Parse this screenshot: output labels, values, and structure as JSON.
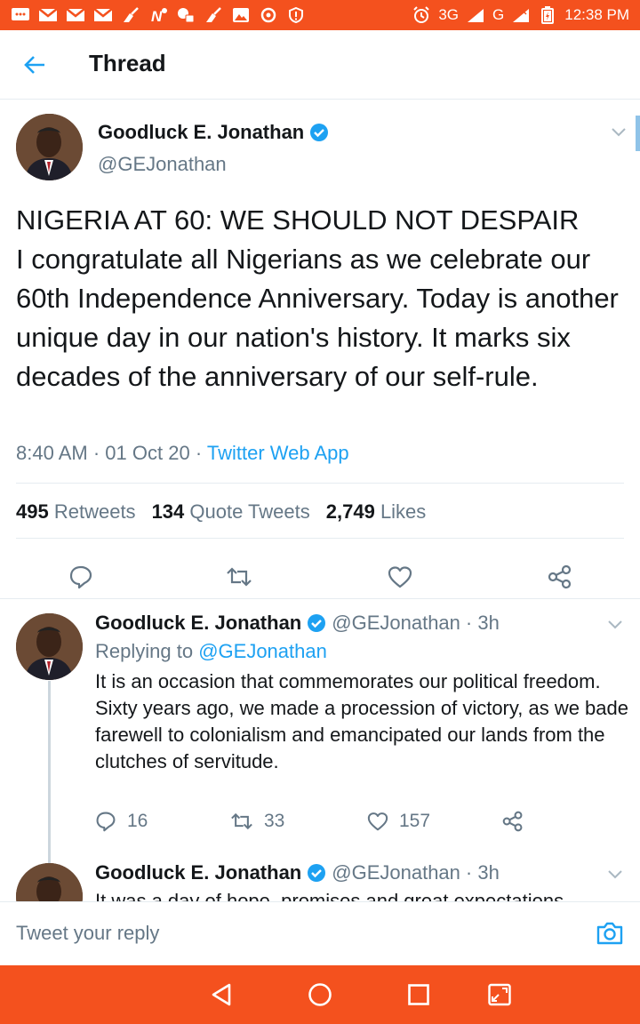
{
  "status_bar": {
    "network": "3G",
    "network_small": "3G",
    "carrier": "G",
    "time": "12:38 PM",
    "background": "#f4511e"
  },
  "header": {
    "title": "Thread",
    "back_icon": "arrow-left-icon"
  },
  "main_tweet": {
    "name": "Goodluck E. Jonathan",
    "handle": "@GEJonathan",
    "verified": true,
    "text": "NIGERIA AT 60: WE SHOULD NOT DESPAIR\nI congratulate all Nigerians as we celebrate our 60th Independence Anniversary. Today is another unique day in our nation's history. It marks six decades of the anniversary of our self-rule.",
    "time": "8:40 AM",
    "date": "01 Oct 20",
    "source": "Twitter Web App",
    "sep": "·",
    "retweets_count": "495",
    "retweets_label": "Retweets",
    "quotes_count": "134",
    "quotes_label": "Quote Tweets",
    "likes_count": "2,749",
    "likes_label": "Likes"
  },
  "replies": [
    {
      "name": "Goodluck E. Jonathan",
      "handle": "@GEJonathan",
      "age": "· 3h",
      "replying_prefix": "Replying to",
      "replying_to": "@GEJonathan",
      "text": "It is an occasion that commemorates our political freedom.\nSixty years ago, we made a procession of victory, as we bade farewell to colonialism and emancipated our lands from the clutches of servitude.",
      "replies": "16",
      "retweets": "33",
      "likes": "157"
    },
    {
      "name": "Goodluck E. Jonathan",
      "handle": "@GEJonathan",
      "age": "· 3h",
      "text": "It was a day of hope, promises and great expectations"
    }
  ],
  "reply_bar": {
    "placeholder": "Tweet your reply"
  },
  "colors": {
    "accent": "#1da1f2",
    "muted": "#657786",
    "android_bar": "#f4511e"
  }
}
